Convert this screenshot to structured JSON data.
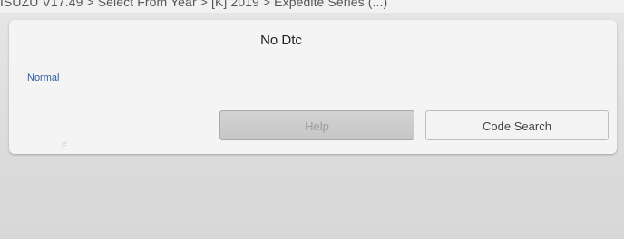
{
  "header": {
    "breadcrumb": "ISUZU V17.49 > Select From Year > [K] 2019 > Expedite Series (...)"
  },
  "panel": {
    "title": "No Dtc",
    "status_label": "Normal",
    "help_label": "Help",
    "code_search_label": "Code Search",
    "corner_mark": "E"
  },
  "colors": {
    "status_text": "#2e5fa4",
    "help_disabled_text": "#9a9a9a"
  }
}
